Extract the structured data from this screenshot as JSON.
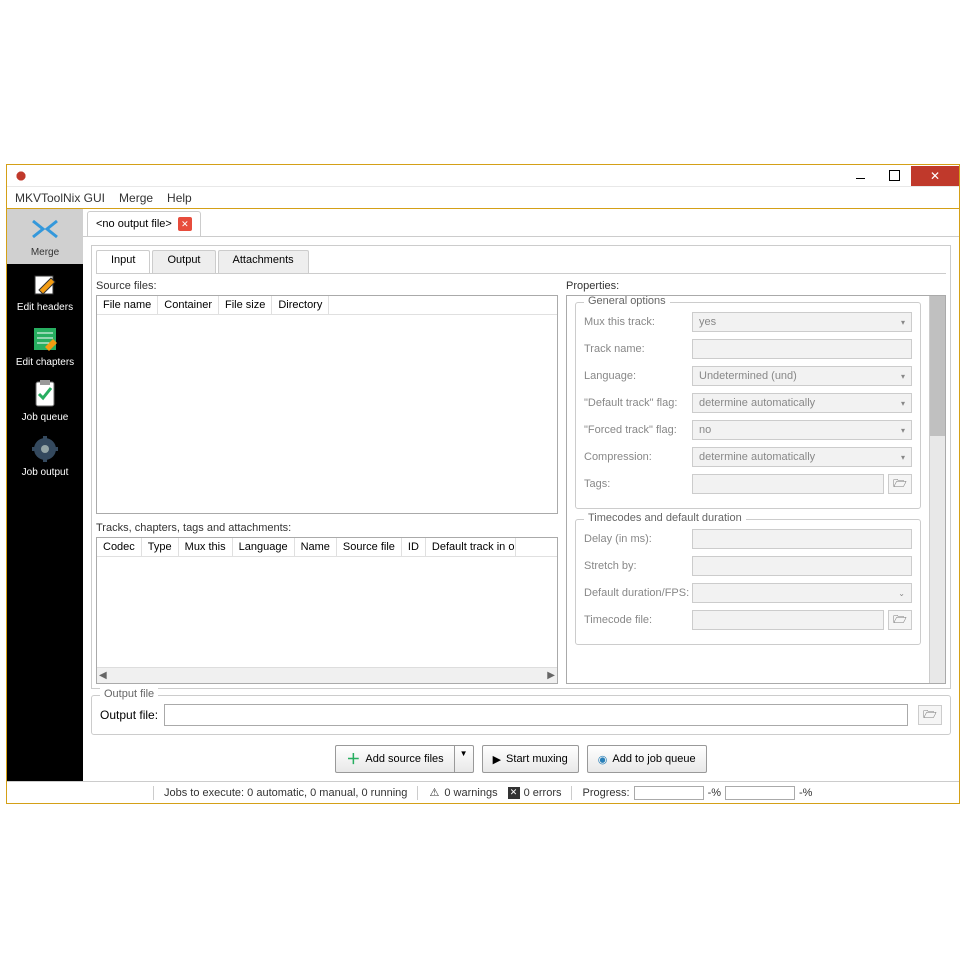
{
  "menubar": {
    "items": [
      "MKVToolNix GUI",
      "Merge",
      "Help"
    ]
  },
  "sidebar": {
    "items": [
      {
        "label": "Merge"
      },
      {
        "label": "Edit headers"
      },
      {
        "label": "Edit chapters"
      },
      {
        "label": "Job queue"
      },
      {
        "label": "Job output"
      }
    ]
  },
  "file_tab": {
    "label": "<no output file>"
  },
  "sub_tabs": {
    "input": "Input",
    "output": "Output",
    "attachments": "Attachments"
  },
  "labels": {
    "source_files": "Source files:",
    "tracks": "Tracks, chapters, tags and attachments:",
    "properties": "Properties:",
    "output_group": "Output file",
    "output_file": "Output file:"
  },
  "source_cols": [
    "File name",
    "Container",
    "File size",
    "Directory"
  ],
  "track_cols": [
    "Codec",
    "Type",
    "Mux this",
    "Language",
    "Name",
    "Source file",
    "ID",
    "Default track in output"
  ],
  "props": {
    "general": {
      "title": "General options",
      "mux_label": "Mux this track:",
      "mux_value": "yes",
      "trackname_label": "Track name:",
      "language_label": "Language:",
      "language_value": "Undetermined (und)",
      "default_label": "\"Default track\" flag:",
      "default_value": "determine automatically",
      "forced_label": "\"Forced track\" flag:",
      "forced_value": "no",
      "compression_label": "Compression:",
      "compression_value": "determine automatically",
      "tags_label": "Tags:"
    },
    "timecodes": {
      "title": "Timecodes and default duration",
      "delay_label": "Delay (in ms):",
      "stretch_label": "Stretch by:",
      "fps_label": "Default duration/FPS:",
      "tcfile_label": "Timecode file:"
    }
  },
  "buttons": {
    "add_source": "Add source files",
    "start_muxing": "Start muxing",
    "add_queue": "Add to job queue"
  },
  "status": {
    "jobs": "Jobs to execute:  0 automatic, 0 manual, 0 running",
    "warnings": "0 warnings",
    "errors": "0 errors",
    "progress": "Progress:",
    "pct": "-%"
  }
}
